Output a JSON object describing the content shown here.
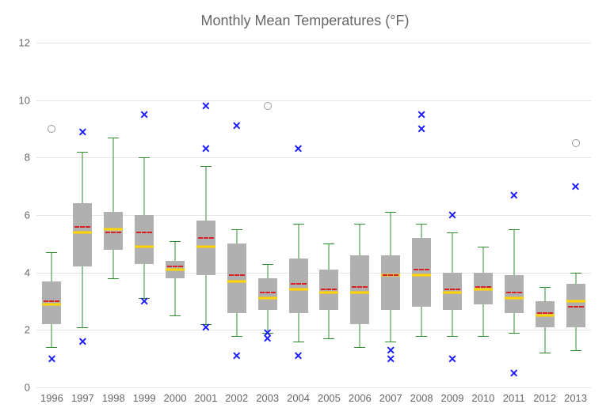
{
  "chart_data": {
    "type": "box",
    "title": "Monthly Mean Temperatures (°F)",
    "xlabel": "",
    "ylabel": "",
    "ylim": [
      0,
      12
    ],
    "y_ticks": [
      0,
      2,
      4,
      6,
      8,
      10,
      12
    ],
    "categories": [
      "1996",
      "1997",
      "1998",
      "1999",
      "2000",
      "2001",
      "2002",
      "2003",
      "2004",
      "2005",
      "2006",
      "2007",
      "2008",
      "2009",
      "2010",
      "2011",
      "2012",
      "2013"
    ],
    "series": [
      {
        "name": "Monthly Mean Temp",
        "boxes": [
          {
            "category": "1996",
            "whisker_low": 1.4,
            "q1": 2.2,
            "median": 2.9,
            "mean": 3.0,
            "q3": 3.7,
            "whisker_high": 4.7,
            "outliers_x": [
              1.0
            ],
            "outliers_o": [
              9.0
            ]
          },
          {
            "category": "1997",
            "whisker_low": 2.1,
            "q1": 4.2,
            "median": 5.4,
            "mean": 5.6,
            "q3": 6.4,
            "whisker_high": 8.2,
            "outliers_x": [
              1.6,
              8.9
            ],
            "outliers_o": []
          },
          {
            "category": "1998",
            "whisker_low": 3.8,
            "q1": 4.8,
            "median": 5.5,
            "mean": 5.4,
            "q3": 6.1,
            "whisker_high": 8.7,
            "outliers_x": [],
            "outliers_o": []
          },
          {
            "category": "1999",
            "whisker_low": 3.1,
            "q1": 4.3,
            "median": 4.9,
            "mean": 5.4,
            "q3": 6.0,
            "whisker_high": 8.0,
            "outliers_x": [
              3.0,
              9.5
            ],
            "outliers_o": []
          },
          {
            "category": "2000",
            "whisker_low": 2.5,
            "q1": 3.8,
            "median": 4.1,
            "mean": 4.2,
            "q3": 4.4,
            "whisker_high": 5.1,
            "outliers_x": [],
            "outliers_o": []
          },
          {
            "category": "2001",
            "whisker_low": 2.2,
            "q1": 3.9,
            "median": 4.9,
            "mean": 5.2,
            "q3": 5.8,
            "whisker_high": 7.7,
            "outliers_x": [
              2.1,
              8.3,
              9.8
            ],
            "outliers_o": []
          },
          {
            "category": "2002",
            "whisker_low": 1.8,
            "q1": 2.6,
            "median": 3.7,
            "mean": 3.9,
            "q3": 5.0,
            "whisker_high": 5.5,
            "outliers_x": [
              1.1,
              9.1
            ],
            "outliers_o": []
          },
          {
            "category": "2003",
            "whisker_low": 1.9,
            "q1": 2.7,
            "median": 3.1,
            "mean": 3.3,
            "q3": 3.8,
            "whisker_high": 4.3,
            "outliers_x": [
              1.7,
              1.9
            ],
            "outliers_o": [
              9.8
            ]
          },
          {
            "category": "2004",
            "whisker_low": 1.6,
            "q1": 2.6,
            "median": 3.4,
            "mean": 3.6,
            "q3": 4.5,
            "whisker_high": 5.7,
            "outliers_x": [
              1.1,
              8.3
            ],
            "outliers_o": []
          },
          {
            "category": "2005",
            "whisker_low": 1.7,
            "q1": 2.7,
            "median": 3.3,
            "mean": 3.4,
            "q3": 4.1,
            "whisker_high": 5.0,
            "outliers_x": [],
            "outliers_o": []
          },
          {
            "category": "2006",
            "whisker_low": 1.4,
            "q1": 2.2,
            "median": 3.3,
            "mean": 3.5,
            "q3": 4.6,
            "whisker_high": 5.7,
            "outliers_x": [],
            "outliers_o": []
          },
          {
            "category": "2007",
            "whisker_low": 1.6,
            "q1": 2.7,
            "median": 3.9,
            "mean": 3.9,
            "q3": 4.6,
            "whisker_high": 6.1,
            "outliers_x": [
              1.0,
              1.3
            ],
            "outliers_o": []
          },
          {
            "category": "2008",
            "whisker_low": 1.8,
            "q1": 2.8,
            "median": 3.9,
            "mean": 4.1,
            "q3": 5.2,
            "whisker_high": 5.7,
            "outliers_x": [
              9.0,
              9.5
            ],
            "outliers_o": []
          },
          {
            "category": "2009",
            "whisker_low": 1.8,
            "q1": 2.7,
            "median": 3.3,
            "mean": 3.4,
            "q3": 4.0,
            "whisker_high": 5.4,
            "outliers_x": [
              1.0,
              6.0
            ],
            "outliers_o": []
          },
          {
            "category": "2010",
            "whisker_low": 1.8,
            "q1": 2.9,
            "median": 3.4,
            "mean": 3.5,
            "q3": 4.0,
            "whisker_high": 4.9,
            "outliers_x": [],
            "outliers_o": []
          },
          {
            "category": "2011",
            "whisker_low": 1.9,
            "q1": 2.6,
            "median": 3.1,
            "mean": 3.3,
            "q3": 3.9,
            "whisker_high": 5.5,
            "outliers_x": [
              0.5,
              6.7
            ],
            "outliers_o": []
          },
          {
            "category": "2012",
            "whisker_low": 1.2,
            "q1": 2.1,
            "median": 2.5,
            "mean": 2.6,
            "q3": 3.0,
            "whisker_high": 3.5,
            "outliers_x": [],
            "outliers_o": []
          },
          {
            "category": "2013",
            "whisker_low": 1.3,
            "q1": 2.1,
            "median": 3.0,
            "mean": 2.8,
            "q3": 3.6,
            "whisker_high": 4.0,
            "outliers_x": [
              7.0
            ],
            "outliers_o": [
              8.5
            ]
          }
        ]
      }
    ]
  }
}
